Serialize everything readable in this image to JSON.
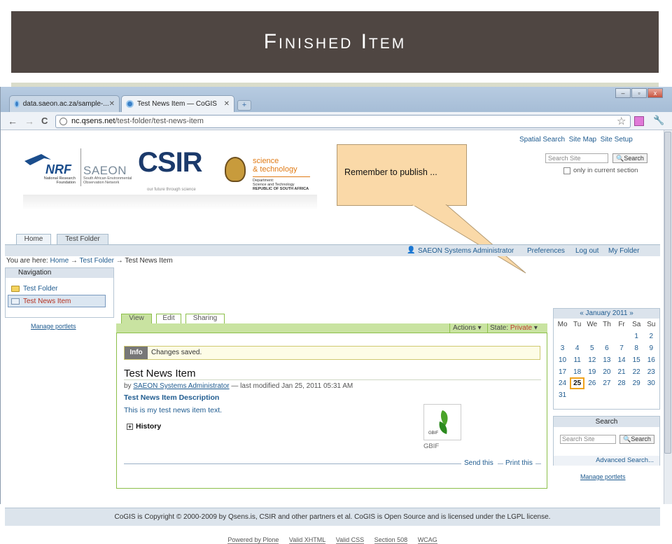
{
  "slide": {
    "title": "Finished Item"
  },
  "browser": {
    "tabs": [
      {
        "label": "data.saeon.ac.za/sample-..."
      },
      {
        "label": "Test News Item — CoGIS"
      }
    ],
    "new_tab": "+",
    "window_controls": [
      "–",
      "▫",
      "x"
    ],
    "url_host": "nc.qsens.net",
    "url_path": "/test-folder/test-news-item",
    "nav_icons": {
      "back": "←",
      "forward": "→",
      "reload": "C"
    }
  },
  "site": {
    "top_links": [
      "Spatial Search",
      "Site Map",
      "Site Setup"
    ],
    "logos": {
      "nrf_name": "NRF",
      "nrf_sub": "National Research Foundation",
      "saeon_name": "SAEON",
      "saeon_sub": "South African Environmental Observation Network",
      "csir_name": "CSIR",
      "csir_tag": "our future through science",
      "dst_line1": "science",
      "dst_line2": "& technology",
      "dst_sub1": "Department:",
      "dst_sub2": "Science and Technology",
      "dst_sub3": "REPUBLIC OF SOUTH AFRICA"
    },
    "search": {
      "placeholder": "Search Site",
      "button": "Search",
      "only_current": "only in current section"
    },
    "callout": "Remember to publish ...",
    "section_tabs": [
      "Home",
      "Test Folder"
    ],
    "personal_bar": {
      "user": "SAEON Systems Administrator",
      "links": [
        "Preferences",
        "Log out",
        "My Folder"
      ]
    },
    "breadcrumb": {
      "prefix": "You are here:",
      "items": [
        "Home",
        "Test Folder",
        "Test News Item"
      ]
    },
    "navigation": {
      "title": "Navigation",
      "items": [
        "Test Folder",
        "Test News Item"
      ],
      "manage": "Manage portlets"
    },
    "content": {
      "tabs": [
        "View",
        "Edit",
        "Sharing"
      ],
      "actions": "Actions ▾",
      "state_label": "State:",
      "state_value": "Private",
      "state_arrow": "▾",
      "info_label": "Info",
      "info_text": "Changes saved.",
      "title": "Test News Item",
      "by": "by",
      "author": "SAEON Systems Administrator",
      "modified": "— last modified Jan 25, 2011 05:31 AM",
      "description": "Test News Item Description",
      "body": "This is my test news item text.",
      "history": "History",
      "image_caption": "GBIF",
      "image_mark": "GBIF",
      "send_this": "Send this",
      "print_this": "Print this"
    },
    "calendar": {
      "title": "« January 2011 »",
      "days": [
        "Mo",
        "Tu",
        "We",
        "Th",
        "Fr",
        "Sa",
        "Su"
      ],
      "weeks": [
        [
          "",
          "",
          "",
          "",
          "",
          "1",
          "2"
        ],
        [
          "3",
          "4",
          "5",
          "6",
          "7",
          "8",
          "9"
        ],
        [
          "10",
          "11",
          "12",
          "13",
          "14",
          "15",
          "16"
        ],
        [
          "17",
          "18",
          "19",
          "20",
          "21",
          "22",
          "23"
        ],
        [
          "24",
          "25",
          "26",
          "27",
          "28",
          "29",
          "30"
        ],
        [
          "31",
          "",
          "",
          "",
          "",
          "",
          ""
        ]
      ],
      "today": "25"
    },
    "side_search": {
      "title": "Search",
      "placeholder": "Search Site",
      "button": "Search",
      "advanced": "Advanced Search..."
    },
    "manage_right": "Manage portlets",
    "footer": "CoGIS is Copyright © 2000-2009 by Qsens.is, CSIR and other partners et al. CoGIS is Open Source and is licensed under the LGPL license.",
    "colophon": [
      "Powered by Plone",
      "Valid XHTML",
      "Valid CSS",
      "Section 508",
      "WCAG"
    ]
  },
  "colors": {
    "title_bar": "#4f4642",
    "accent_green": "#8cbf4a",
    "state_private": "#c0392b",
    "callout": "#fad9a8"
  }
}
